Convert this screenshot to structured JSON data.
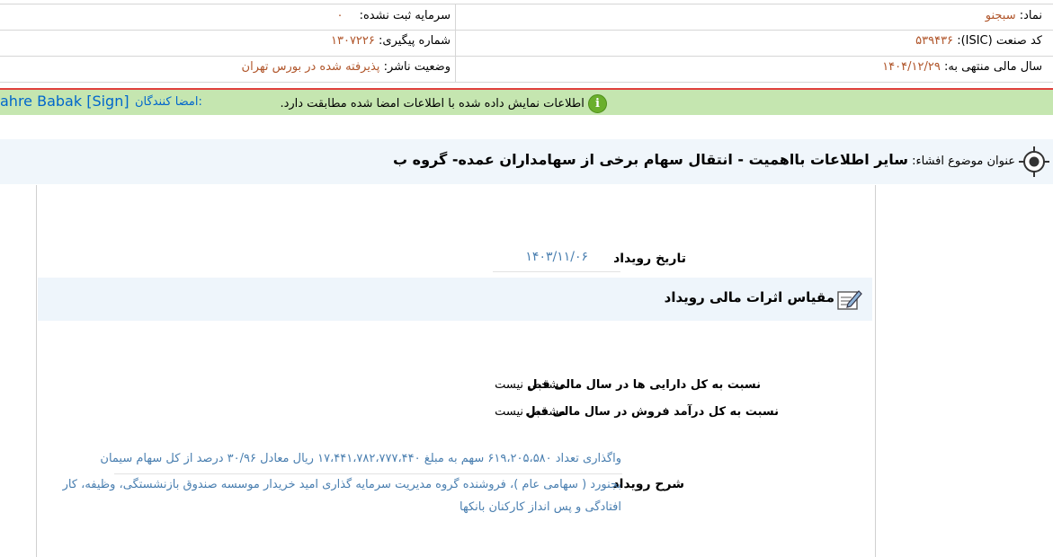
{
  "info": {
    "symbol_label": "نماد:",
    "symbol_value": "سبجنو",
    "unregistered_capital_label": "سرمایه ثبت نشده:",
    "unregistered_capital_value": "۰",
    "isic_label": "کد صنعت (ISIC):",
    "isic_value": "۵۳۹۴۳۶",
    "tracking_label": "شماره پیگیری:",
    "tracking_value": "۱۳۰۷۲۲۶",
    "fiscal_year_label": "سال مالی منتهی به:",
    "fiscal_year_value": "۱۴۰۴/۱۲/۲۹",
    "publisher_status_label": "وضعیت ناشر:",
    "publisher_status_value": "پذیرفته شده در بورس تهران"
  },
  "signature": {
    "message": "اطلاعات نمایش داده شده با اطلاعات امضا شده مطابقت دارد.",
    "signers_label": "امضا کنندگان:",
    "signer_name": "ahre Babak [Sign]",
    "colors": {
      "bar": "#c5e6b0",
      "info_icon": "#6aaf2c",
      "link": "#0066cc"
    }
  },
  "title": {
    "label": "عنوان موضوع افشاء:",
    "text": "سایر اطلاعات بااهمیت - انتقال سهام برخی از سهامداران عمده- گروه ب",
    "icon": "target-icon"
  },
  "event_date": {
    "label": "تاریخ رویداد",
    "value": "۱۴۰۳/۱۱/۰۶"
  },
  "financial_effect": {
    "heading": "مقیاس اثرات مالی رویداد",
    "icon": "edit-note-icon",
    "rows": [
      {
        "label": "نسبت به کل دارایی ها در سال مالی قبل",
        "value": "مشخص نیست"
      },
      {
        "label": "نسبت به کل درآمد فروش در سال مالی قبل",
        "value": "مشخص نیست"
      }
    ]
  },
  "description": {
    "label": "شرح رویداد",
    "line1": "واگذاری تعداد ۶۱۹،۲۰۵،۵۸۰ سهم به مبلغ ۱۷،۴۴۱،۷۸۲،۷۷۷،۴۴۰ ریال معادل ۳۰/۹۶ درصد از کل سهام سیمان",
    "line2": "بجنورد ( سهامی عام )، فروشنده گروه مدیریت سرمایه گذاری امید خریدار موسسه صندوق بازنشستگی، وظیفه، کار",
    "line3": "افتادگی و پس انداز کارکنان بانکها"
  }
}
